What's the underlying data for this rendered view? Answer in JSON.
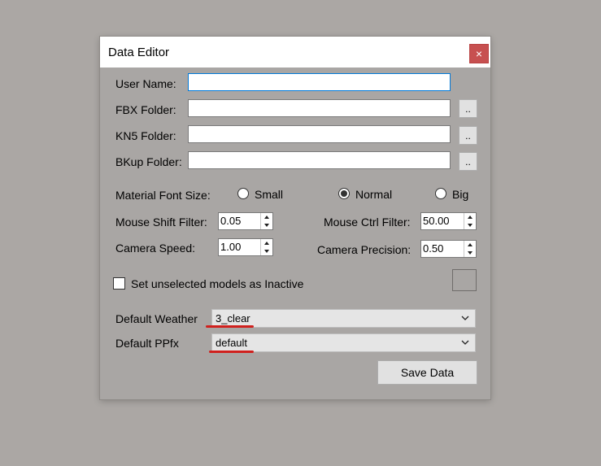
{
  "window": {
    "title": "Data Editor",
    "close_glyph": "×"
  },
  "folders": {
    "user_name_label": "User Name:",
    "fbx_label": "FBX Folder:",
    "kn5_label": "KN5 Folder:",
    "bkup_label": "BKup Folder:",
    "user_name_value": "",
    "fbx_value": "",
    "kn5_value": "",
    "bkup_value": "",
    "browse_label": ".."
  },
  "font_size": {
    "label": "Material Font Size:",
    "options": [
      {
        "label": "Small",
        "selected": false
      },
      {
        "label": "Normal",
        "selected": true
      },
      {
        "label": "Big",
        "selected": false
      }
    ]
  },
  "settings": {
    "mouse_shift_label": "Mouse Shift Filter:",
    "mouse_shift_value": "0.05",
    "mouse_ctrl_label": "Mouse Ctrl Filter:",
    "mouse_ctrl_value": "50.00",
    "camera_speed_label": "Camera Speed:",
    "camera_speed_value": "1.00",
    "camera_precision_label": "Camera Precision:",
    "camera_precision_value": "0.50"
  },
  "inactive": {
    "label": "Set unselected models as Inactive",
    "checked": false
  },
  "defaults": {
    "weather_label": "Default Weather",
    "weather_value": "3_clear",
    "ppfx_label": "Default PPfx",
    "ppfx_value": "default"
  },
  "actions": {
    "save_label": "Save Data"
  },
  "colors": {
    "accent_focus": "#0078d7",
    "close_bg": "#c75050",
    "annotation": "#d0201d"
  }
}
